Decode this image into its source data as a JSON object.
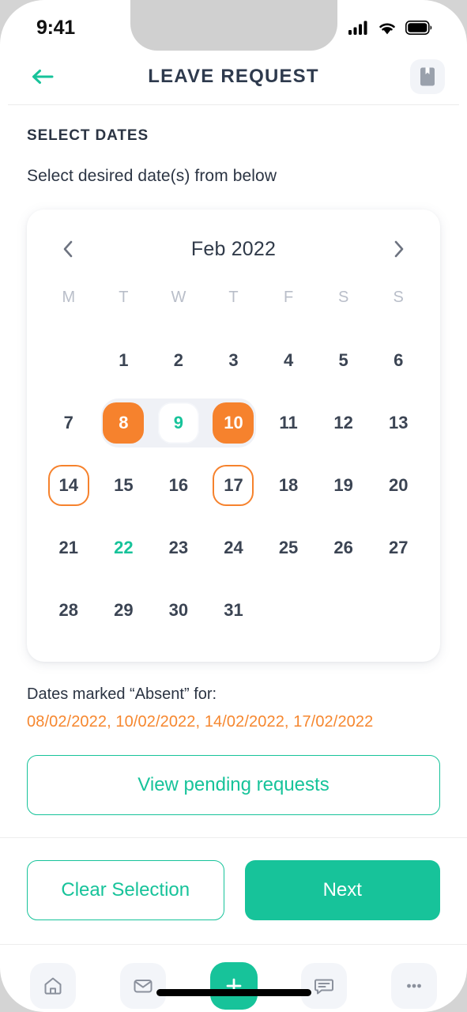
{
  "statusbar": {
    "time": "9:41",
    "icons": [
      "signal-icon",
      "wifi-icon",
      "battery-icon"
    ]
  },
  "navbar": {
    "title": "LEAVE REQUEST",
    "back_icon": "arrow-left-icon",
    "action_icon": "bookmark-icon"
  },
  "main": {
    "section_label": "SELECT DATES",
    "section_sub": "Select desired date(s) from below",
    "absent_label": "Dates marked “Absent” for:",
    "absent_dates": "08/02/2022, 10/02/2022, 14/02/2022, 17/02/2022",
    "view_pending_label": "View pending requests"
  },
  "calendar": {
    "month_title": "Feb 2022",
    "prev_icon": "chevron-left-icon",
    "next_icon": "chevron-right-icon",
    "day_headers": [
      "M",
      "T",
      "W",
      "T",
      "F",
      "S",
      "S"
    ],
    "leading_blanks": 1,
    "days": [
      {
        "n": "1",
        "state": "normal"
      },
      {
        "n": "2",
        "state": "normal"
      },
      {
        "n": "3",
        "state": "normal"
      },
      {
        "n": "4",
        "state": "normal"
      },
      {
        "n": "5",
        "state": "normal"
      },
      {
        "n": "6",
        "state": "normal"
      },
      {
        "n": "7",
        "state": "normal"
      },
      {
        "n": "8",
        "state": "selected-solid",
        "band": "start"
      },
      {
        "n": "9",
        "state": "selected-mid",
        "band": "middle"
      },
      {
        "n": "10",
        "state": "selected-solid",
        "band": "end"
      },
      {
        "n": "11",
        "state": "normal"
      },
      {
        "n": "12",
        "state": "normal"
      },
      {
        "n": "13",
        "state": "normal"
      },
      {
        "n": "14",
        "state": "selected-ring"
      },
      {
        "n": "15",
        "state": "normal"
      },
      {
        "n": "16",
        "state": "normal"
      },
      {
        "n": "17",
        "state": "selected-ring"
      },
      {
        "n": "18",
        "state": "normal"
      },
      {
        "n": "19",
        "state": "normal"
      },
      {
        "n": "20",
        "state": "normal"
      },
      {
        "n": "21",
        "state": "normal"
      },
      {
        "n": "22",
        "state": "today"
      },
      {
        "n": "23",
        "state": "normal"
      },
      {
        "n": "24",
        "state": "normal"
      },
      {
        "n": "25",
        "state": "normal"
      },
      {
        "n": "26",
        "state": "normal"
      },
      {
        "n": "27",
        "state": "normal"
      },
      {
        "n": "28",
        "state": "normal"
      },
      {
        "n": "29",
        "state": "normal"
      },
      {
        "n": "30",
        "state": "normal"
      },
      {
        "n": "31",
        "state": "normal"
      }
    ]
  },
  "actions": {
    "clear_label": "Clear Selection",
    "next_label": "Next"
  },
  "tabbar": {
    "items": [
      {
        "icon": "home-icon",
        "name": "tab-home"
      },
      {
        "icon": "mail-icon",
        "name": "tab-mail"
      },
      {
        "icon": "plus-icon",
        "name": "tab-add"
      },
      {
        "icon": "chat-icon",
        "name": "tab-chat"
      },
      {
        "icon": "more-icon",
        "name": "tab-more"
      }
    ]
  },
  "colors": {
    "teal": "#17c39a",
    "orange": "#f6822d",
    "navy": "#2e3a4d",
    "muted": "#b9bec9",
    "band": "#eff1f6"
  }
}
